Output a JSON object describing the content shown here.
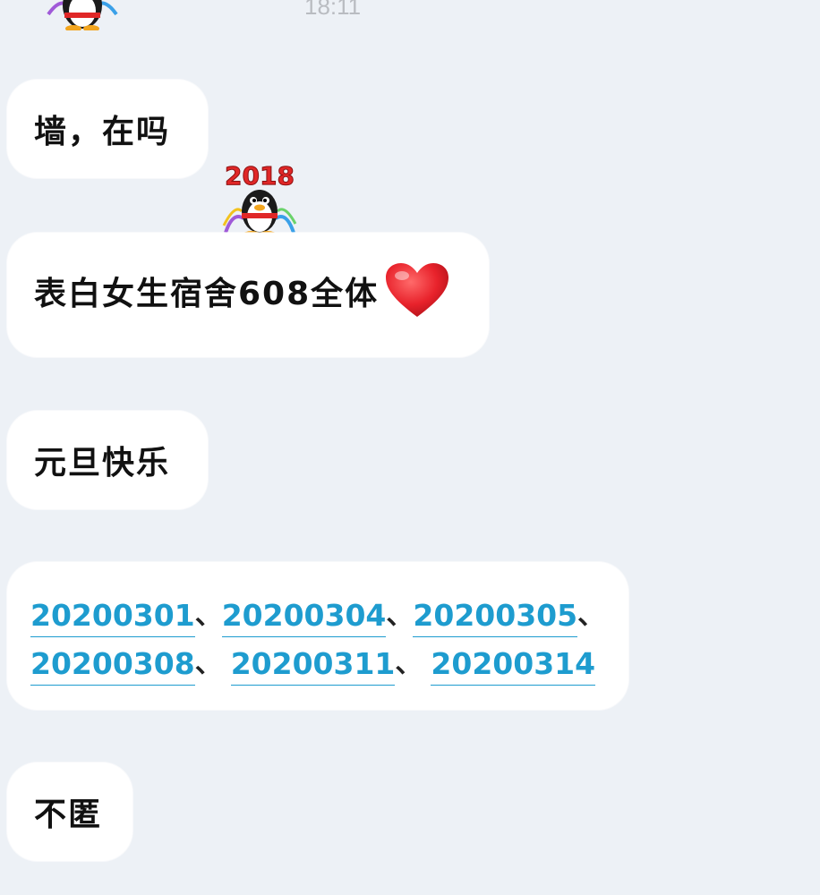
{
  "chat": {
    "timestamp": "18:11",
    "messages": [
      {
        "text": "墙，在吗"
      },
      {
        "text": "表白女生宿舍608全体",
        "emoji": "red-heart"
      },
      {
        "text": "元旦快乐"
      },
      {
        "links": [
          "20200301",
          "20200304",
          "20200305",
          "20200308",
          "20200311",
          "20200314"
        ],
        "separator": "、"
      },
      {
        "text": "不匿"
      }
    ],
    "sticker": {
      "label": "2018",
      "name": "penguin-2018-sticker"
    }
  },
  "colors": {
    "background": "#edf1f6",
    "bubble": "#ffffff",
    "link": "#1e9ccf",
    "heart": "#e8222b",
    "sticker_text": "#e02727"
  }
}
